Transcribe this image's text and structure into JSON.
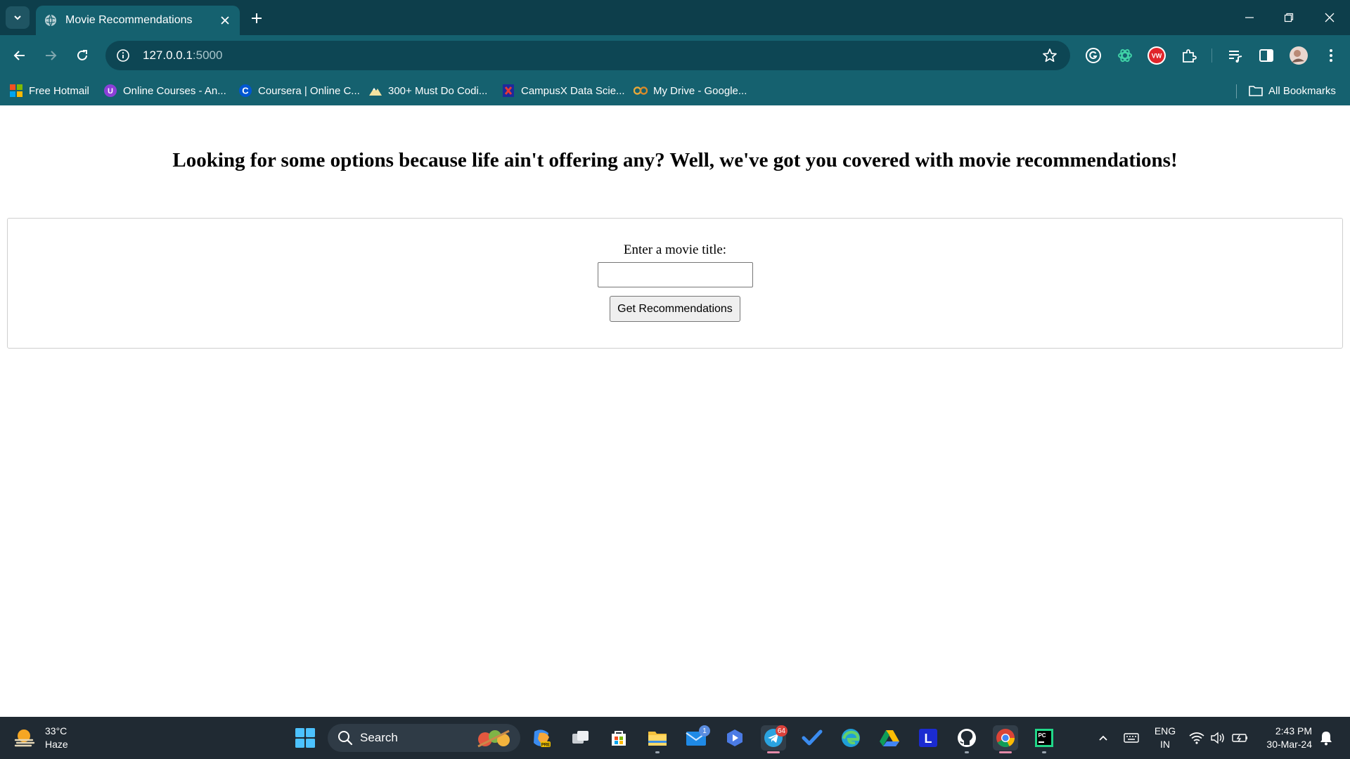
{
  "browser": {
    "tab": {
      "title": "Movie Recommendations"
    },
    "url": {
      "host": "127.0.0.1",
      "port": ":5000"
    },
    "bookmarks": [
      {
        "label": "Free Hotmail",
        "icon": "windows-logo-icon"
      },
      {
        "label": "Online Courses - An...",
        "icon": "online-courses-icon"
      },
      {
        "label": "Coursera | Online C...",
        "icon": "coursera-icon"
      },
      {
        "label": "300+ Must Do Codi...",
        "icon": "mountain-icon"
      },
      {
        "label": "CampusX Data Scie...",
        "icon": "campusx-icon"
      },
      {
        "label": "My Drive - Google...",
        "icon": "drive-icon"
      }
    ],
    "all_bookmarks_label": "All Bookmarks",
    "extensions": [
      "grammarly-icon",
      "chatgpt-icon",
      "vw-extension-icon",
      "puzzle-icon"
    ],
    "colors": {
      "frame": "#0d3e4b",
      "toolbar": "#15616f"
    }
  },
  "page": {
    "headline": "Looking for some options because life ain't offering any? Well, we've got you covered with movie recommendations!",
    "form": {
      "label": "Enter a movie title:",
      "input_value": "",
      "button_label": "Get Recommendations"
    }
  },
  "taskbar": {
    "weather": {
      "temp": "33°C",
      "condition": "Haze"
    },
    "search_label": "Search",
    "badges": {
      "mail": "1",
      "telegram": "64"
    },
    "language": {
      "line1": "ENG",
      "line2": "IN"
    },
    "clock": {
      "time": "2:43 PM",
      "date": "30-Mar-24"
    },
    "colors": {
      "bar": "#202a33"
    }
  }
}
